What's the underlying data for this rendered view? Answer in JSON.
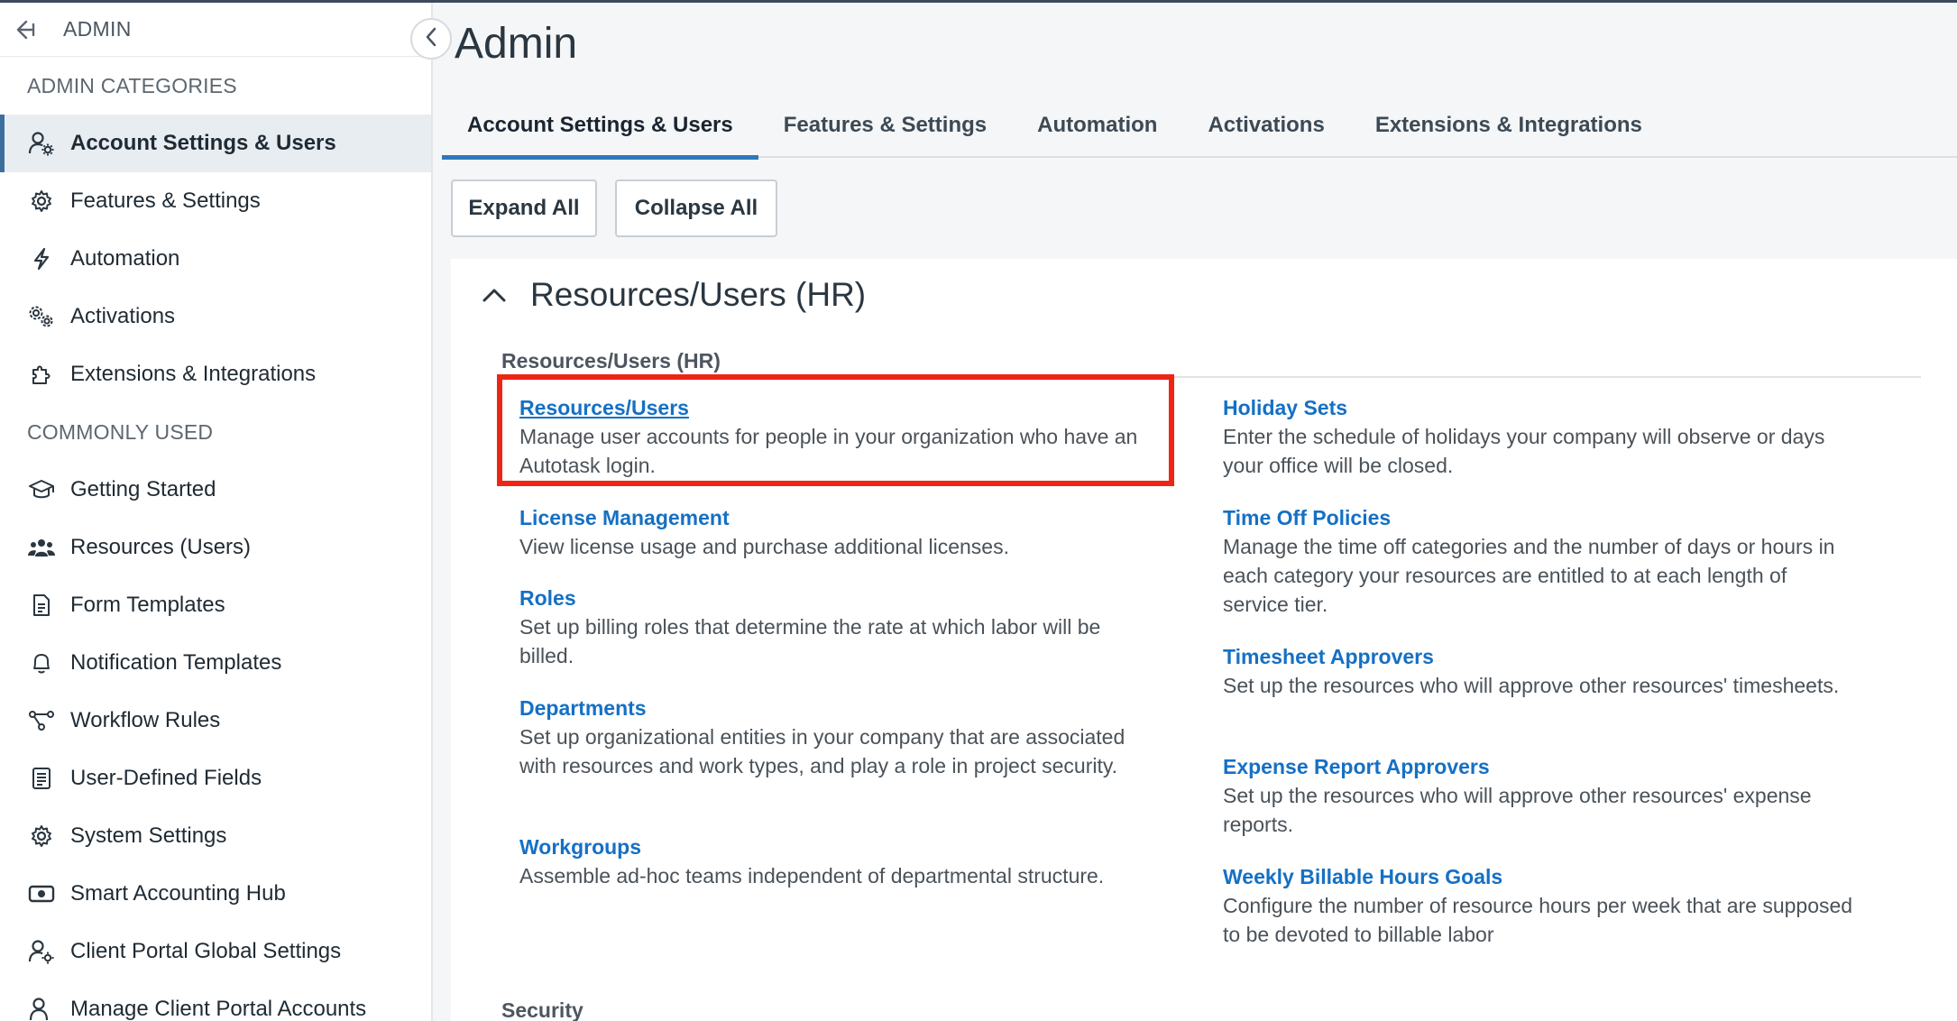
{
  "sidebar": {
    "header_title": "ADMIN",
    "section_categories": "ADMIN CATEGORIES",
    "categories": [
      {
        "label": "Account Settings & Users",
        "icon": "user-gear-icon",
        "active": true
      },
      {
        "label": "Features & Settings",
        "icon": "gear-icon"
      },
      {
        "label": "Automation",
        "icon": "lightning-icon"
      },
      {
        "label": "Activations",
        "icon": "gears-icon"
      },
      {
        "label": "Extensions & Integrations",
        "icon": "puzzle-icon"
      }
    ],
    "section_common": "COMMONLY USED",
    "common": [
      {
        "label": "Getting Started",
        "icon": "graduation-cap-icon"
      },
      {
        "label": "Resources (Users)",
        "icon": "users-icon"
      },
      {
        "label": "Form Templates",
        "icon": "document-icon"
      },
      {
        "label": "Notification Templates",
        "icon": "bell-icon"
      },
      {
        "label": "Workflow Rules",
        "icon": "workflow-icon"
      },
      {
        "label": "User-Defined Fields",
        "icon": "list-icon"
      },
      {
        "label": "System Settings",
        "icon": "gear-icon"
      },
      {
        "label": "Smart Accounting Hub",
        "icon": "money-icon"
      },
      {
        "label": "Client Portal Global Settings",
        "icon": "user-gear-icon"
      },
      {
        "label": "Manage Client Portal Accounts",
        "icon": "user-icon"
      }
    ]
  },
  "main": {
    "title": "Admin",
    "tabs": [
      {
        "label": "Account Settings & Users",
        "active": true
      },
      {
        "label": "Features & Settings"
      },
      {
        "label": "Automation"
      },
      {
        "label": "Activations"
      },
      {
        "label": "Extensions & Integrations"
      }
    ],
    "expand_all": "Expand All",
    "collapse_all": "Collapse All",
    "panel_title": "Resources/Users (HR)",
    "subsection_title": "Resources/Users (HR)",
    "next_subsection": "Security",
    "left_entries": [
      {
        "title": "Resources/Users",
        "desc": "Manage user accounts for people in your organization who have an Autotask login."
      },
      {
        "title": "License Management",
        "desc": "View license usage and purchase additional licenses."
      },
      {
        "title": "Roles",
        "desc": "Set up billing roles that determine the rate at which labor will be billed."
      },
      {
        "title": "Departments",
        "desc": "Set up organizational entities in your company that are associated with resources and work types, and play a role in project security."
      },
      {
        "title": "Workgroups",
        "desc": "Assemble ad-hoc teams independent of departmental structure."
      }
    ],
    "right_entries": [
      {
        "title": "Holiday Sets",
        "desc": "Enter the schedule of holidays your company will observe or days your office will be closed."
      },
      {
        "title": "Time Off Policies",
        "desc": "Manage the time off categories and the number of days or hours in each category your resources are entitled to at each length of service tier."
      },
      {
        "title": "Timesheet Approvers",
        "desc": "Set up the resources who will approve other resources' timesheets."
      },
      {
        "title": "Expense Report Approvers",
        "desc": "Set up the resources who will approve other resources' expense reports."
      },
      {
        "title": "Weekly Billable Hours Goals",
        "desc": "Configure the number of resource hours per week that are supposed to be devoted to billable labor"
      }
    ]
  },
  "colors": {
    "link": "#1570c4",
    "highlight": "#ee2515",
    "active_tab": "#2f79b9"
  }
}
